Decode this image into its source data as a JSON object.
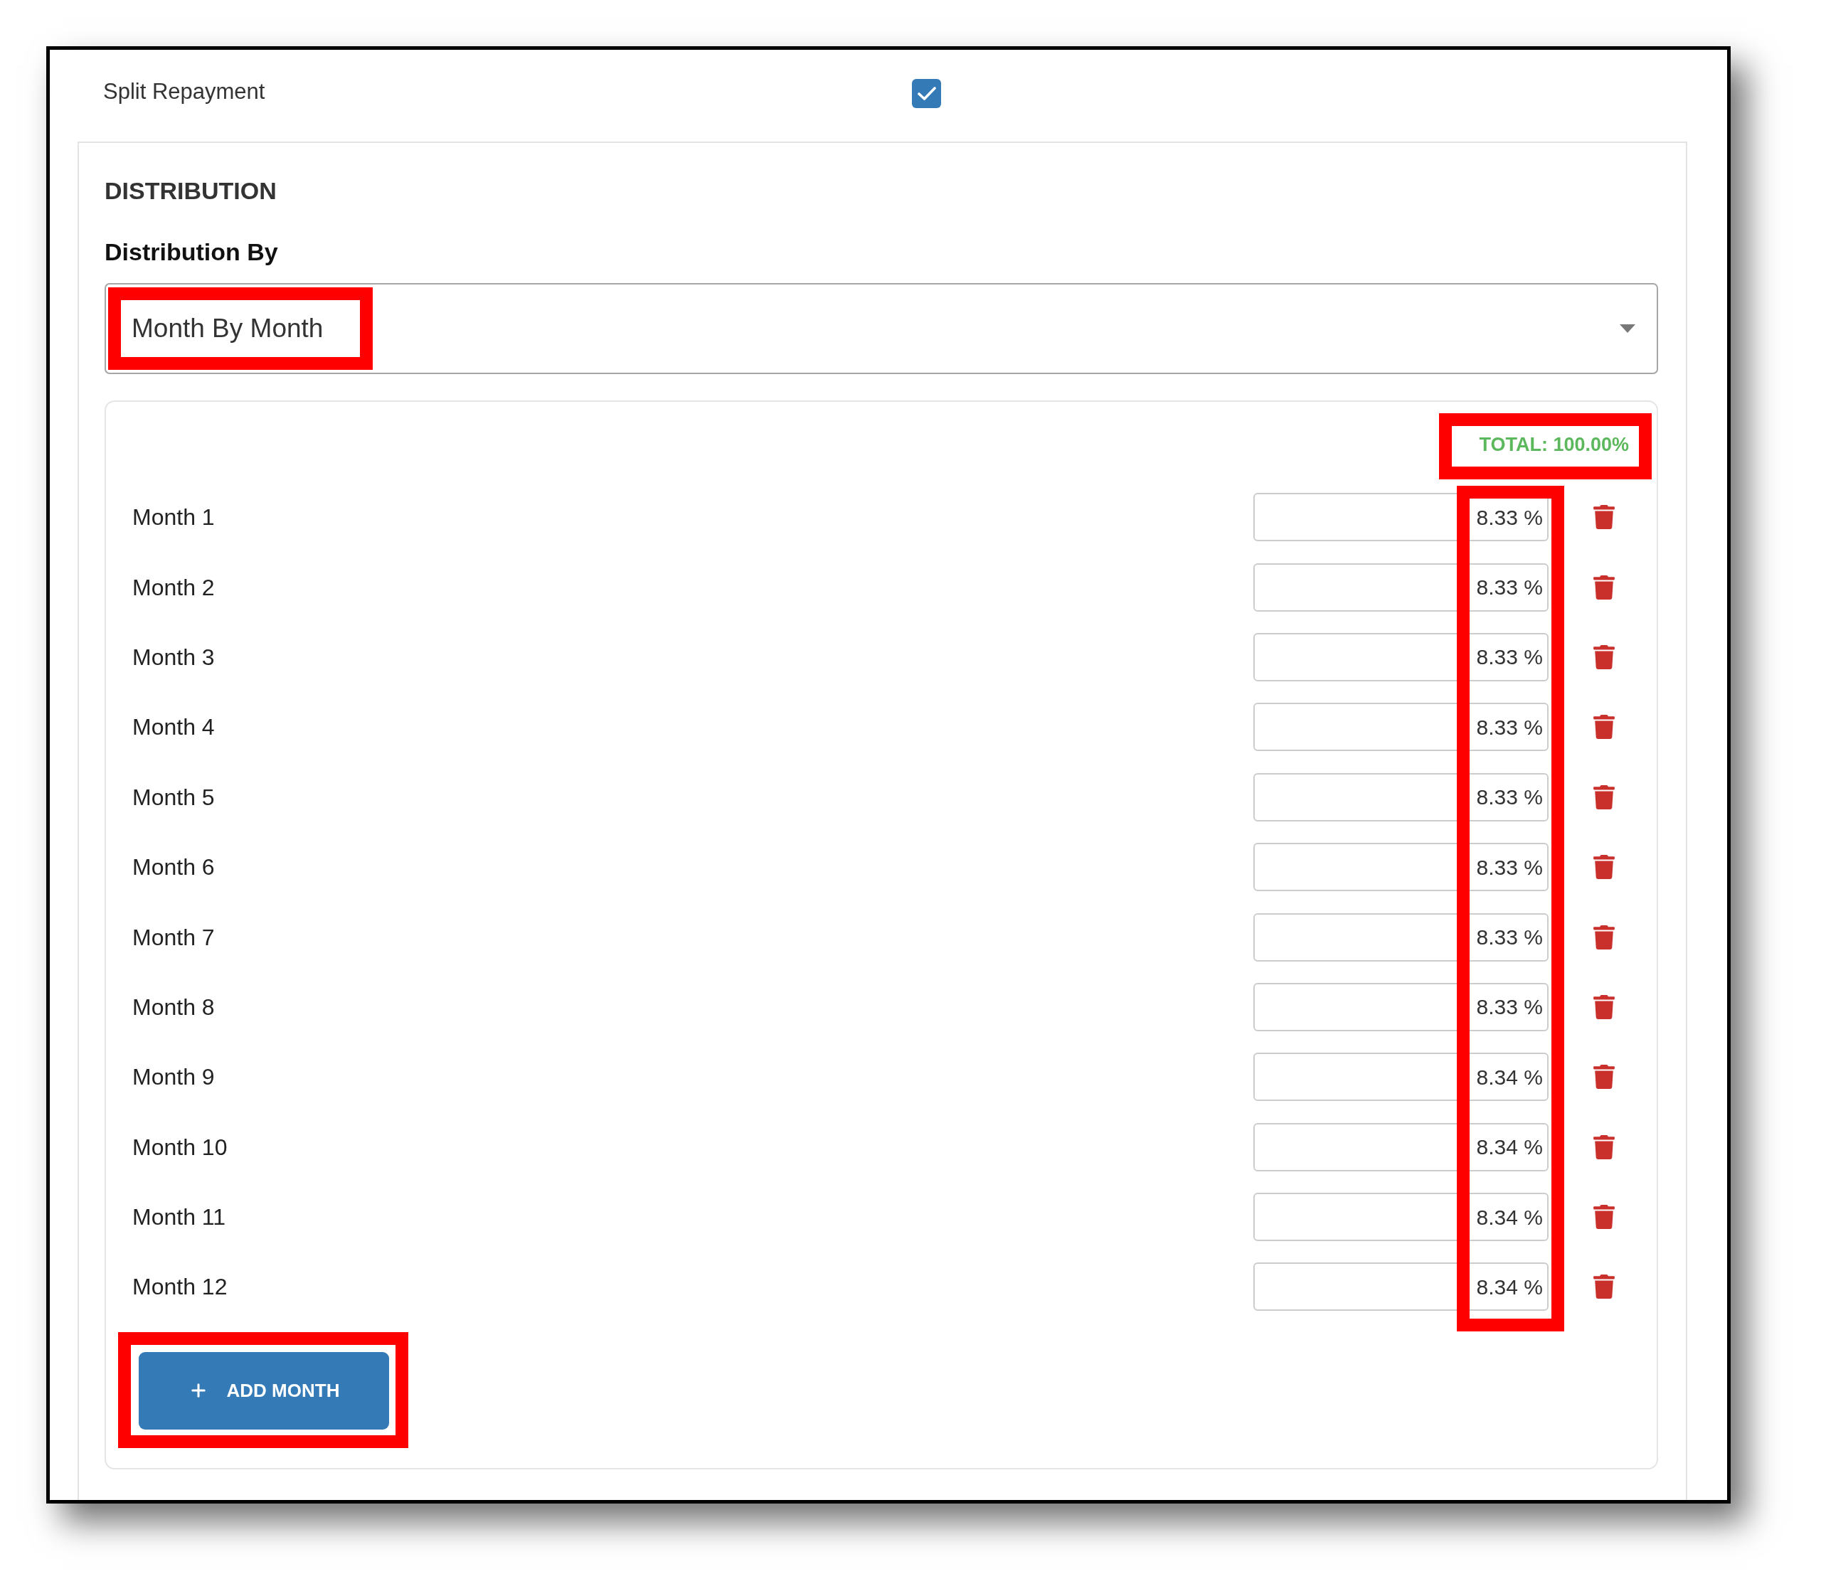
{
  "split_repayment": {
    "label": "Split Repayment",
    "checked": true
  },
  "distribution": {
    "heading": "DISTRIBUTION",
    "field_label": "Distribution By",
    "select": {
      "value": "Month By Month",
      "highlighted": true
    },
    "total": {
      "text": "TOTAL: 100.00%",
      "highlighted": true
    },
    "percent_column": {
      "highlighted": true
    },
    "months": [
      {
        "label": "Month 1",
        "value": "8.33 %"
      },
      {
        "label": "Month 2",
        "value": "8.33 %"
      },
      {
        "label": "Month 3",
        "value": "8.33 %"
      },
      {
        "label": "Month 4",
        "value": "8.33 %"
      },
      {
        "label": "Month 5",
        "value": "8.33 %"
      },
      {
        "label": "Month 6",
        "value": "8.33 %"
      },
      {
        "label": "Month 7",
        "value": "8.33 %"
      },
      {
        "label": "Month 8",
        "value": "8.33 %"
      },
      {
        "label": "Month 9",
        "value": "8.34 %"
      },
      {
        "label": "Month 10",
        "value": "8.34 %"
      },
      {
        "label": "Month 11",
        "value": "8.34 %"
      },
      {
        "label": "Month 12",
        "value": "8.34 %"
      }
    ],
    "add_button": {
      "label": "ADD MONTH",
      "highlighted": true
    }
  }
}
